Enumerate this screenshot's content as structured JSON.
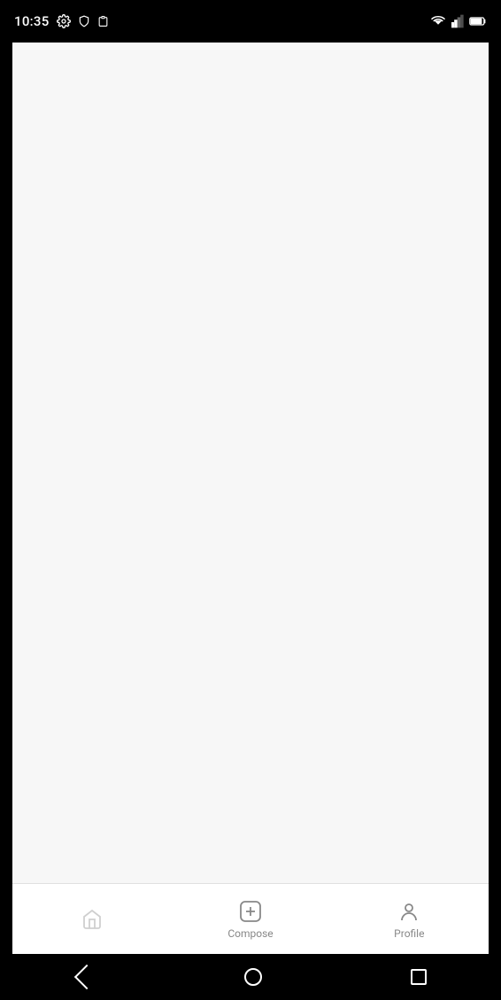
{
  "statusBar": {
    "time": "10:35",
    "icons": [
      "settings",
      "shield",
      "clipboard"
    ]
  },
  "bottomNav": {
    "items": [
      {
        "id": "home",
        "label": "",
        "icon": "home-icon"
      },
      {
        "id": "compose",
        "label": "Compose",
        "icon": "compose-icon"
      },
      {
        "id": "profile",
        "label": "Profile",
        "icon": "profile-icon"
      }
    ]
  },
  "androidNav": {
    "back_label": "back",
    "home_label": "home",
    "recents_label": "recents"
  },
  "colors": {
    "background": "#f7f7f7",
    "navBackground": "#ffffff",
    "iconColor": "#888888",
    "statusBarBg": "#000000",
    "androidNavBg": "#000000"
  }
}
